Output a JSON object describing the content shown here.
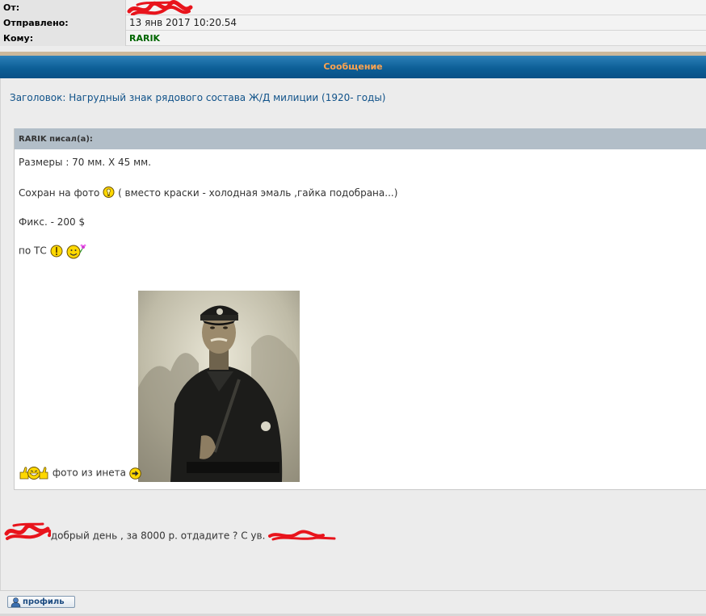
{
  "header": {
    "from_label": "От:",
    "sent_label": "Отправлено:",
    "sent_value": "13 янв 2017 10:20.54",
    "to_label": "Кому:",
    "to_value": "RARIK"
  },
  "message_bar": {
    "title": "Сообщение"
  },
  "message": {
    "subject": "Заголовок: Нагрудный знак рядового состава Ж/Д милиции (1920- годы)",
    "quote_author": "RARIK писал(а):",
    "quote_lines": {
      "size": "Размеры : 70 мм. Х 45 мм.",
      "condition_prefix": "Сохран на фото",
      "condition_suffix": "( вместо краски - холодная эмаль ,гайка подобрана...)",
      "price": "Фикс. - 200 $",
      "delivery": "по ТС",
      "photo_caption": "фото из инета"
    },
    "reply": "добрый день , за 8000 р. отдадите ? С ув."
  },
  "footer": {
    "profile_label": "профиль"
  },
  "colors": {
    "blue_bar": "#0d5f97",
    "bar_title": "#ffa34f",
    "subject": "#105289",
    "to_value": "#006600",
    "redaction": "#e8141c"
  },
  "icons": [
    "idea-smiley-icon",
    "exclaim-smiley-icon",
    "flower-smiley-icon",
    "thumbs-up-smiley-icon",
    "arrow-smiley-icon",
    "profile-icon"
  ]
}
